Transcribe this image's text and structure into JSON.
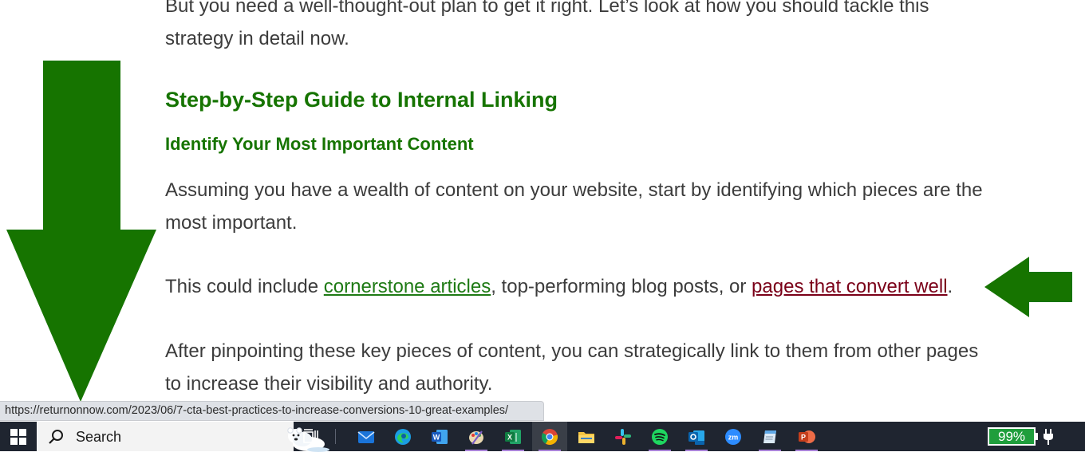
{
  "article": {
    "intro": "But you need a well-thought-out plan to get it right. Let’s look at how you should tackle this strategy in detail now.",
    "heading": "Step-by-Step Guide to Internal Linking",
    "subheading": "Identify Your Most Important Content",
    "paragraph1": "Assuming you have a wealth of content on your website, start by identifying which pieces are the most important.",
    "paragraph2": {
      "prefix": "This could include ",
      "link1": "cornerstone articles",
      "middle": ", top-performing blog posts, or ",
      "link2": "pages that convert well",
      "suffix": "."
    },
    "paragraph3": "After pinpointing these key pieces of content, you can strategically link to them from other pages to increase their visibility and authority."
  },
  "annotations": {
    "arrow_color": "#167400"
  },
  "status_bar": {
    "url": "https://returnonnow.com/2023/06/7-cta-best-practices-to-increase-conversions-10-great-examples/"
  },
  "taskbar": {
    "search_label": "Search",
    "apps": [
      "task-view",
      "mail",
      "edge",
      "word",
      "paint",
      "excel",
      "chrome",
      "file-explorer",
      "slack",
      "spotify",
      "outlook",
      "zoom",
      "notepad",
      "powerpoint"
    ],
    "battery": "99%",
    "battery_color": "#1f9e3c"
  }
}
